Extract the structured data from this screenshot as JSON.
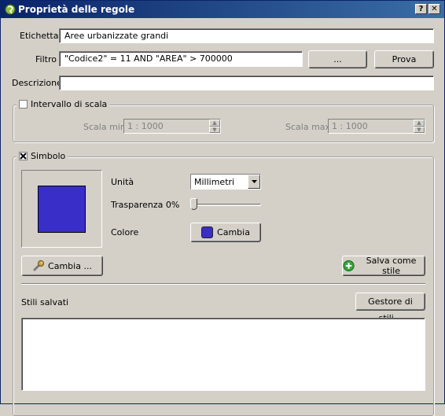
{
  "window": {
    "title": "Proprietà delle regole",
    "help_label": "?",
    "close_label": "✕"
  },
  "form": {
    "etichetta_label": "Etichetta",
    "etichetta_value": "Aree urbanizzate grandi",
    "filtro_label": "Filtro",
    "filtro_value": "\"Codice2\"  = 11 AND  \"AREA\" > 700000",
    "filtro_builder_label": "...",
    "prova_label": "Prova",
    "descrizione_label": "Descrizione",
    "descrizione_value": ""
  },
  "scale": {
    "group_label": "Intervallo di scala",
    "checked": false,
    "min_label": "Scala min",
    "min_value": "1 : 1000",
    "max_label": "Scala max",
    "max_value": "1 : 1000"
  },
  "symbol": {
    "group_label": "Simbolo",
    "checked": true,
    "fill_color": "#3a2ec8",
    "unit_label": "Unità",
    "unit_value": "Millimetri",
    "transparency_label": "Trasparenza 0%",
    "transparency_percent": 0,
    "color_label": "Colore",
    "color_button_label": "Cambia",
    "change_button_label": "Cambia ...",
    "save_style_label": "Salva come stile",
    "saved_styles_label": "Stili salvati",
    "style_manager_label": "Gestore di stili..."
  }
}
